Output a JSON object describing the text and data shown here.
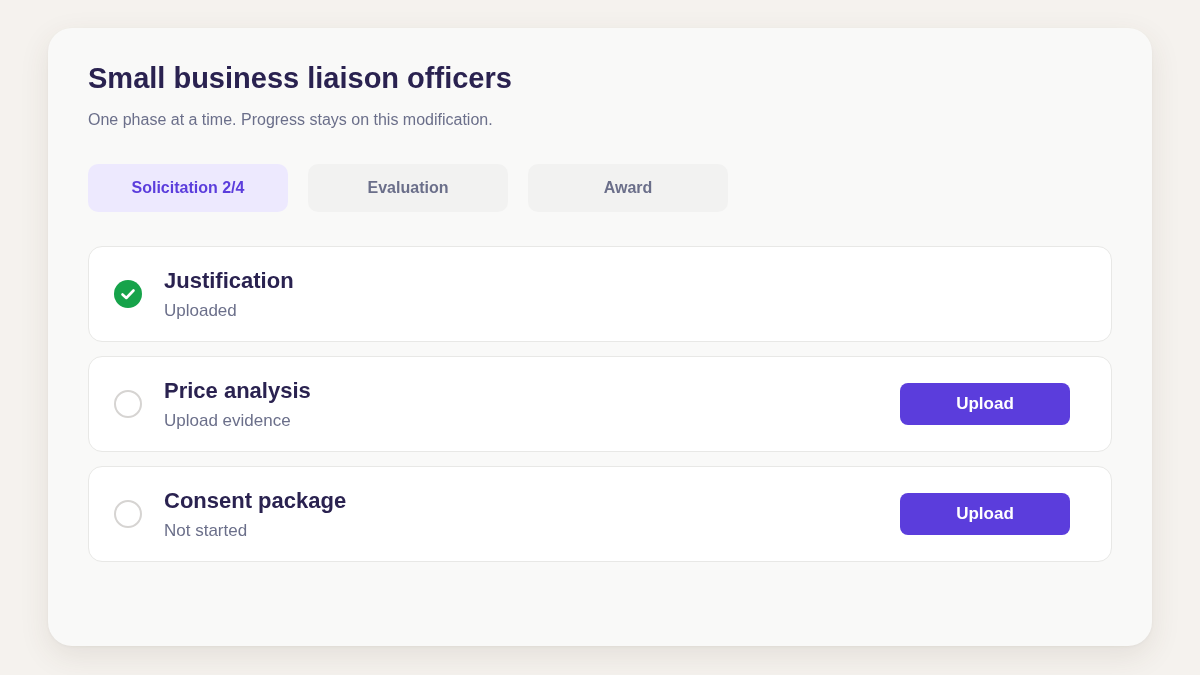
{
  "header": {
    "title": "Small business liaison officers",
    "subtitle": "One phase at a time. Progress stays on this modification."
  },
  "tabs": [
    {
      "label": "Solicitation 2/4",
      "selected": true
    },
    {
      "label": "Evaluation",
      "selected": false
    },
    {
      "label": "Award",
      "selected": false
    }
  ],
  "steps": [
    {
      "title": "Justification",
      "status": "Uploaded",
      "done": true
    },
    {
      "title": "Price analysis",
      "status": "Upload evidence",
      "done": false,
      "action": "Upload"
    },
    {
      "title": "Consent package",
      "status": "Not started",
      "done": false,
      "action": "Upload"
    }
  ]
}
